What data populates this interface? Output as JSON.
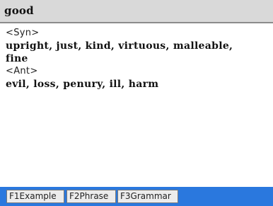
{
  "title": {
    "word": "good"
  },
  "entry": {
    "syn_tag": "<Syn>",
    "synonyms_line1": "upright, just, kind, virtuous, malleable,",
    "synonyms_line2": "fine",
    "ant_tag": "<Ant>",
    "antonyms": "evil, loss, penury, ill, harm"
  },
  "function_keys": [
    {
      "label": "F1Example"
    },
    {
      "label": "F2Phrase"
    },
    {
      "label": "F3Grammar"
    }
  ],
  "colors": {
    "title_bar": "#d9d9d9",
    "bottom_bar": "#2a78de",
    "key_background": "#ececec"
  }
}
